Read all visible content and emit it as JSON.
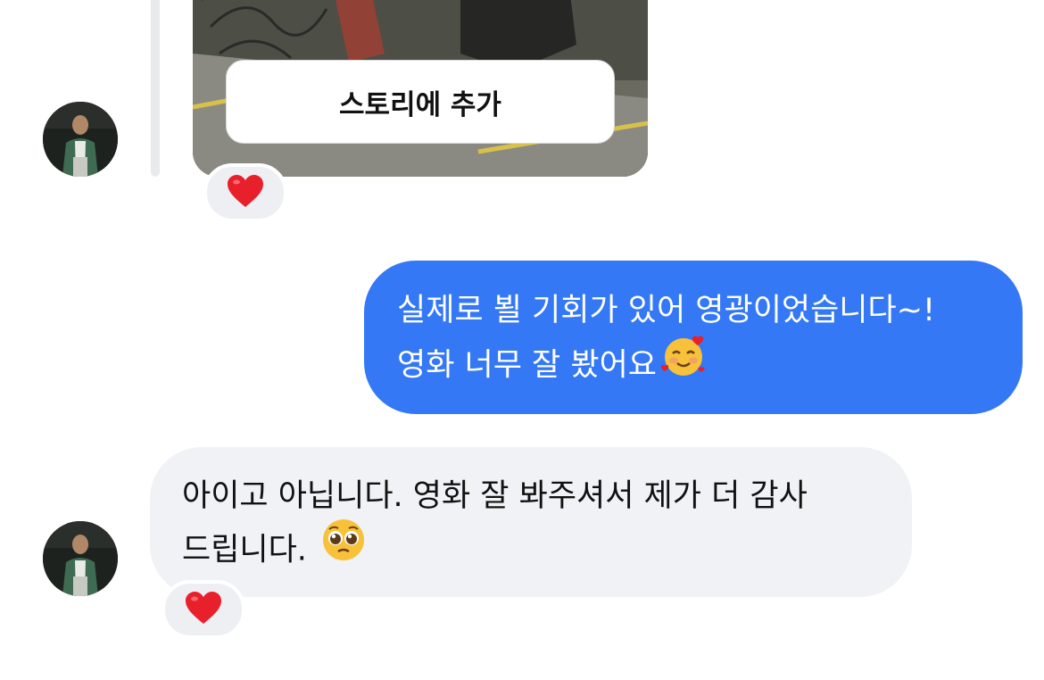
{
  "thread": {
    "story_card": {
      "add_to_story_label": "스토리에 추가",
      "reaction_icon": "heart-icon"
    },
    "messages": [
      {
        "direction": "outgoing",
        "lines": [
          "실제로 뵐 기회가 있어 영광이었습니다~!",
          "영화 너무 잘 봤어요"
        ],
        "emoji": "smiling-face-with-hearts-icon",
        "bubble_color": "#3478f6"
      },
      {
        "direction": "incoming",
        "lines": [
          "아이고 아닙니다. 영화 잘 봐주셔서 제가 더 감사",
          "드립니다."
        ],
        "emoji": "pleading-face-icon",
        "reaction_icon": "heart-icon",
        "bubble_color": "#f1f2f5"
      }
    ]
  },
  "colors": {
    "accent_blue": "#3478f6",
    "incoming_bubble": "#f1f2f5",
    "heart_red": "#e8202b"
  }
}
